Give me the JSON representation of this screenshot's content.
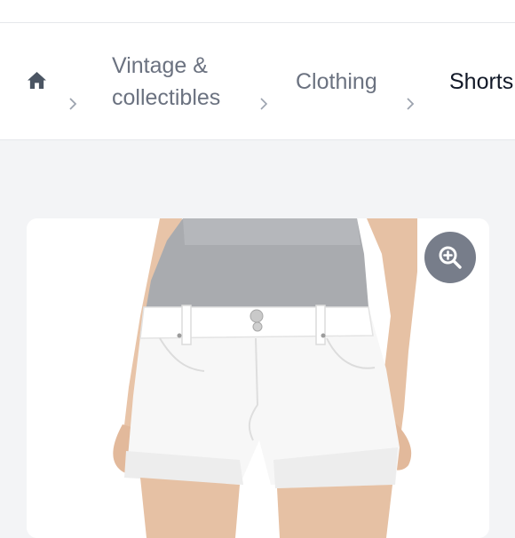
{
  "breadcrumb": {
    "home_icon": "home-icon",
    "items": [
      {
        "label_line1": "Vintage &",
        "label_line2": "collectibles"
      },
      {
        "label": "Clothing"
      },
      {
        "label": "Shorts"
      }
    ],
    "separator_icon": "chevron-right-icon"
  },
  "gallery": {
    "zoom_icon": "zoom-in-icon",
    "photo": "white-denim-shorts-on-model"
  },
  "colors": {
    "page_background": "#f3f4f6",
    "crumb_text": "#6b7280",
    "current_crumb_text": "#111827",
    "zoom_button_bg": "#6b7280"
  }
}
